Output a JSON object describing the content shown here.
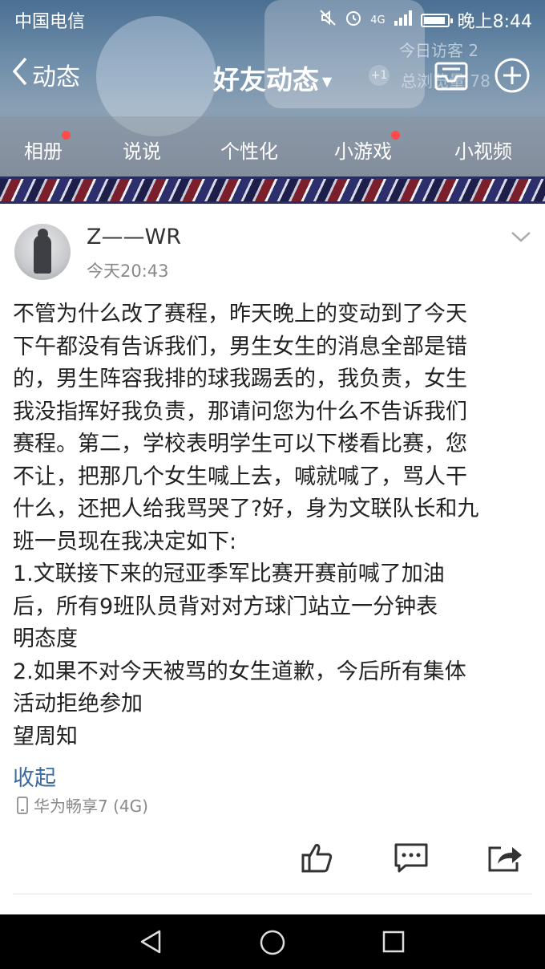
{
  "status_bar": {
    "carrier": "中国电信",
    "time": "晚上8:44",
    "network": "4G"
  },
  "nav": {
    "back_label": "动态",
    "title": "好友动态",
    "visitors_label": "今日访客",
    "visitors_count": "2",
    "total_label": "总浏览量",
    "total_count": "78",
    "plus_one": "+1"
  },
  "tabs": [
    {
      "label": "相册",
      "has_dot": true
    },
    {
      "label": "说说",
      "has_dot": false
    },
    {
      "label": "个性化",
      "has_dot": false
    },
    {
      "label": "小游戏",
      "has_dot": true
    },
    {
      "label": "小视频",
      "has_dot": false
    }
  ],
  "post": {
    "username": "Z——WR",
    "time": "今天20:43",
    "lines": [
      "不管为什么改了赛程，昨天晚上的变动到了今天",
      "下午都没有告诉我们，男生女生的消息全部是错",
      "的，男生阵容我排的球我踢丢的，我负责，女生",
      "我没指挥好我负责，那请问您为什么不告诉我们",
      "赛程。第二，学校表明学生可以下楼看比赛，您",
      "不让，把那几个女生喊上去，喊就喊了，骂人干",
      "什么，还把人给我骂哭了?好，身为文联队长和九",
      "班一员现在我决定如下:",
      "1.文联接下来的冠亚季军比赛开赛前喊了加油",
      "后，所有9班队员背对对方球门站立一分钟表",
      "明态度",
      "2.如果不对今天被骂的女生道歉，今后所有集体",
      "活动拒绝参加",
      "望周知"
    ],
    "collapse_label": "收起",
    "device": "华为畅享7 (4G)"
  },
  "icons": {
    "like": "thumbs-up-icon",
    "comment": "comment-icon",
    "share": "share-icon"
  }
}
